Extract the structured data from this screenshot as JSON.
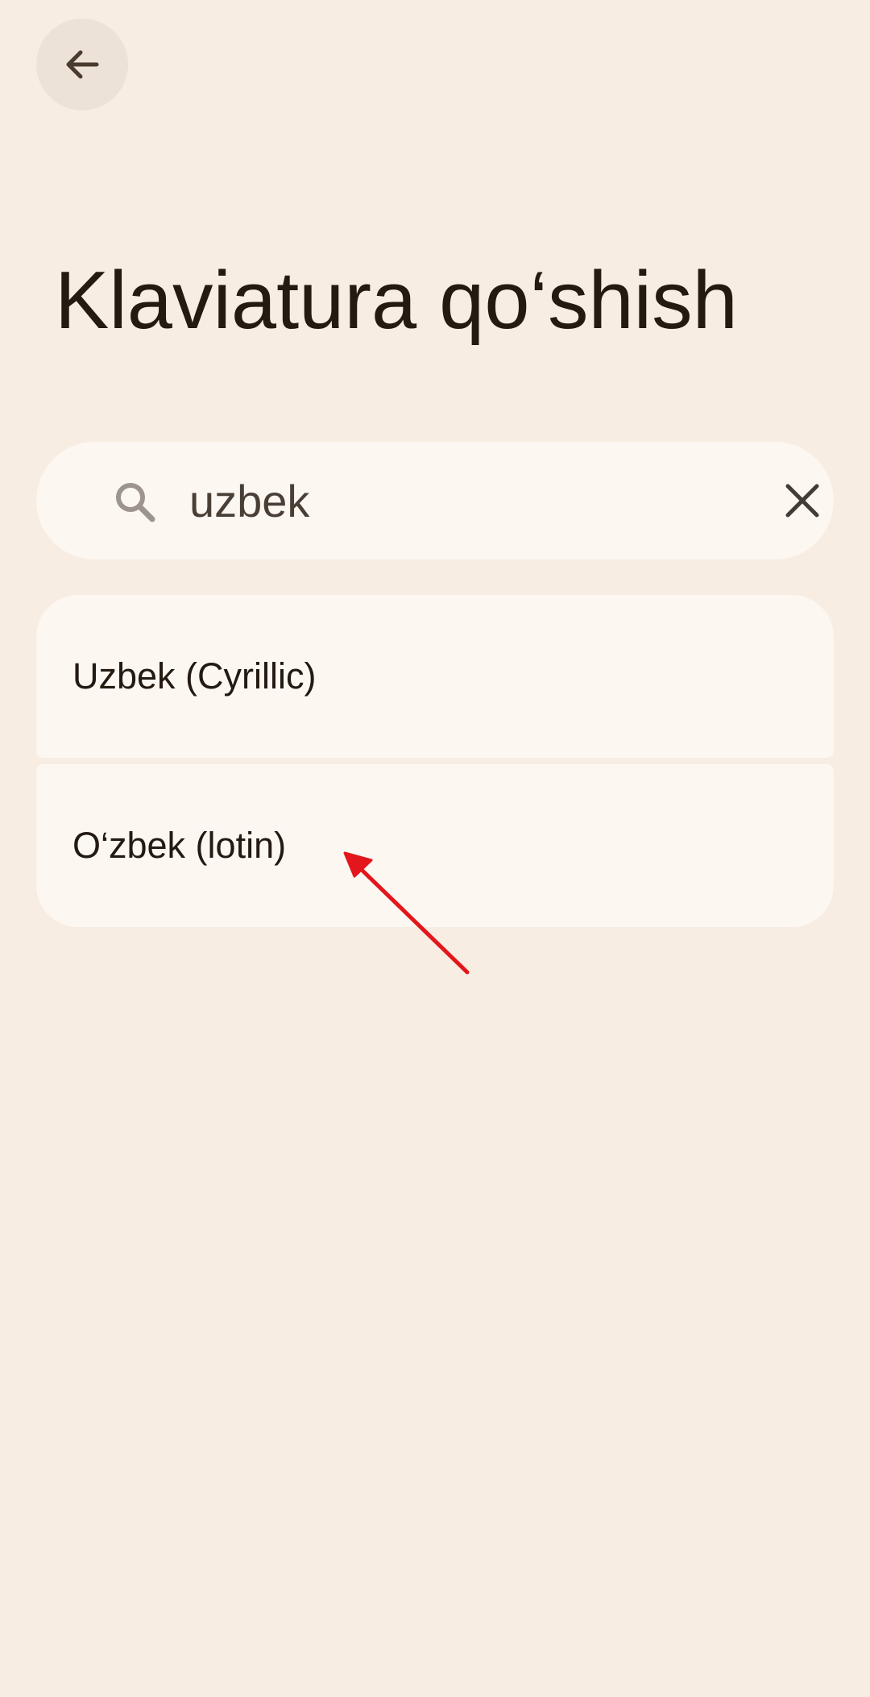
{
  "header": {
    "back_icon": "arrow-left-icon",
    "title": "Klaviatura qo‘shish"
  },
  "search": {
    "value": "uzbek",
    "search_icon": "search-icon",
    "clear_icon": "close-icon"
  },
  "results": [
    {
      "label": "Uzbek (Cyrillic)"
    },
    {
      "label": "O‘zbek (lotin)"
    }
  ],
  "annotation": {
    "type": "arrow",
    "color": "#e3161b",
    "points_to": "results.1"
  },
  "colors": {
    "background": "#f7ede2",
    "surface": "#fdf7f2",
    "back_button_bg": "#ece2d8",
    "text": "#231a12"
  }
}
